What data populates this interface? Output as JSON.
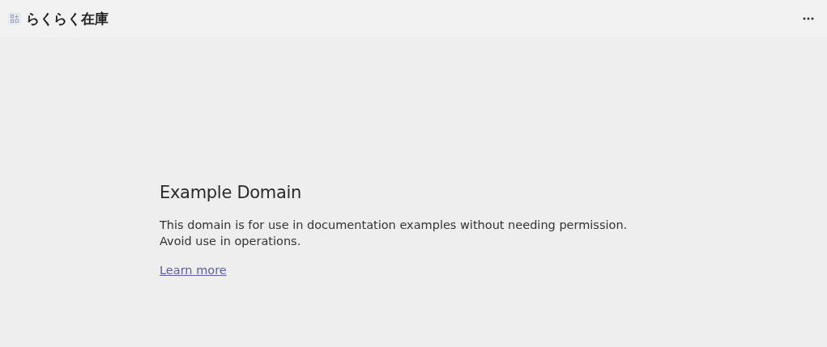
{
  "app": {
    "title": "らくらく在庫"
  },
  "content": {
    "heading": "Example Domain",
    "body": "This domain is for use in documentation examples without needing permission. Avoid use in operations.",
    "link": "Learn more"
  }
}
